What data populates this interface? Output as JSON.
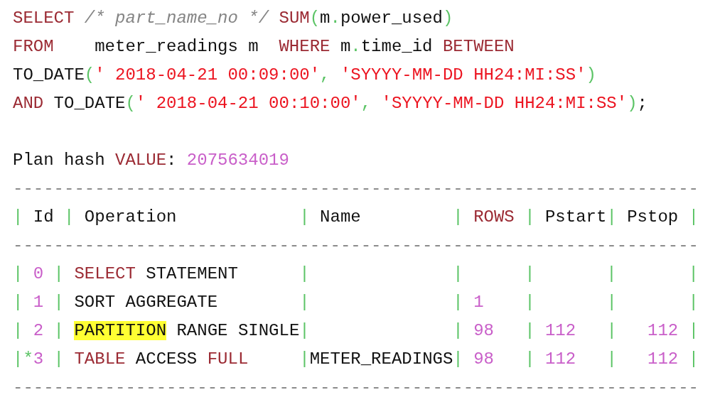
{
  "lines": [
    {
      "kind": "code",
      "tokens": [
        {
          "kind": "kw",
          "text": "SELECT "
        },
        {
          "kind": "cmt",
          "text": "/* part_name_no */ "
        },
        {
          "kind": "kw",
          "text": "SUM"
        },
        {
          "kind": "punct",
          "text": "("
        },
        {
          "kind": "plain",
          "text": "m"
        },
        {
          "kind": "punct",
          "text": "."
        },
        {
          "kind": "plain",
          "text": "power_used"
        },
        {
          "kind": "punct",
          "text": ")"
        }
      ]
    },
    {
      "kind": "code",
      "tokens": [
        {
          "kind": "kw",
          "text": "FROM"
        },
        {
          "kind": "plain",
          "text": "    meter_readings m  "
        },
        {
          "kind": "kw",
          "text": "WHERE"
        },
        {
          "kind": "plain",
          "text": " m"
        },
        {
          "kind": "punct",
          "text": "."
        },
        {
          "kind": "plain",
          "text": "time_id "
        },
        {
          "kind": "kw",
          "text": "BETWEEN"
        }
      ]
    },
    {
      "kind": "code",
      "tokens": [
        {
          "kind": "plain",
          "text": "TO_DATE"
        },
        {
          "kind": "punct",
          "text": "("
        },
        {
          "kind": "str",
          "text": "' 2018-04-21 00:09:00'"
        },
        {
          "kind": "punct",
          "text": ", "
        },
        {
          "kind": "str",
          "text": "'SYYYY-MM-DD HH24:MI:SS'"
        },
        {
          "kind": "punct",
          "text": ")"
        }
      ]
    },
    {
      "kind": "code",
      "tokens": [
        {
          "kind": "kw",
          "text": "AND"
        },
        {
          "kind": "plain",
          "text": " TO_DATE"
        },
        {
          "kind": "punct",
          "text": "("
        },
        {
          "kind": "str",
          "text": "' 2018-04-21 00:10:00'"
        },
        {
          "kind": "punct",
          "text": ", "
        },
        {
          "kind": "str",
          "text": "'SYYYY-MM-DD HH24:MI:SS'"
        },
        {
          "kind": "punct",
          "text": ")"
        },
        {
          "kind": "plain",
          "text": ";"
        }
      ]
    },
    {
      "kind": "blank"
    },
    {
      "kind": "code",
      "tokens": [
        {
          "kind": "plain",
          "text": "Plan hash "
        },
        {
          "kind": "kw",
          "text": "VALUE"
        },
        {
          "kind": "plain",
          "text": ": "
        },
        {
          "kind": "num",
          "text": "2075634019"
        }
      ]
    },
    {
      "kind": "rule",
      "tokens": [
        {
          "kind": "dash",
          "text": "-------------------------------------------------------------------"
        }
      ]
    },
    {
      "kind": "code",
      "tokens": [
        {
          "kind": "punct",
          "text": "|"
        },
        {
          "kind": "plain",
          "text": " Id "
        },
        {
          "kind": "punct",
          "text": "|"
        },
        {
          "kind": "plain",
          "text": " Operation            "
        },
        {
          "kind": "punct",
          "text": "|"
        },
        {
          "kind": "plain",
          "text": " Name         "
        },
        {
          "kind": "punct",
          "text": "| "
        },
        {
          "kind": "kw",
          "text": "ROWS"
        },
        {
          "kind": "punct",
          "text": " |"
        },
        {
          "kind": "plain",
          "text": " Pstart"
        },
        {
          "kind": "punct",
          "text": "|"
        },
        {
          "kind": "plain",
          "text": " Pstop "
        },
        {
          "kind": "punct",
          "text": "|"
        }
      ]
    },
    {
      "kind": "rule",
      "tokens": [
        {
          "kind": "dash",
          "text": "-------------------------------------------------------------------"
        }
      ]
    },
    {
      "kind": "code",
      "tokens": [
        {
          "kind": "punct",
          "text": "| "
        },
        {
          "kind": "num",
          "text": "0"
        },
        {
          "kind": "punct",
          "text": " | "
        },
        {
          "kind": "kw",
          "text": "SELECT"
        },
        {
          "kind": "plain",
          "text": " STATEMENT      "
        },
        {
          "kind": "punct",
          "text": "|              |      |       |       |"
        }
      ]
    },
    {
      "kind": "code",
      "tokens": [
        {
          "kind": "punct",
          "text": "| "
        },
        {
          "kind": "num",
          "text": "1"
        },
        {
          "kind": "punct",
          "text": " |"
        },
        {
          "kind": "plain",
          "text": " SORT AGGREGATE        "
        },
        {
          "kind": "punct",
          "text": "|              | "
        },
        {
          "kind": "num",
          "text": "1"
        },
        {
          "kind": "punct",
          "text": "    |       |       |"
        }
      ]
    },
    {
      "kind": "code",
      "tokens": [
        {
          "kind": "punct",
          "text": "| "
        },
        {
          "kind": "num",
          "text": "2"
        },
        {
          "kind": "punct",
          "text": " | "
        },
        {
          "kind": "mark",
          "text": "PARTITION"
        },
        {
          "kind": "plain",
          "text": " RANGE SINGLE"
        },
        {
          "kind": "punct",
          "text": "|              | "
        },
        {
          "kind": "num",
          "text": "98"
        },
        {
          "kind": "punct",
          "text": "   | "
        },
        {
          "kind": "num",
          "text": "112"
        },
        {
          "kind": "punct",
          "text": "   |   "
        },
        {
          "kind": "num",
          "text": "112"
        },
        {
          "kind": "punct",
          "text": " |"
        }
      ]
    },
    {
      "kind": "code",
      "tokens": [
        {
          "kind": "punct",
          "text": "|*"
        },
        {
          "kind": "num",
          "text": "3"
        },
        {
          "kind": "punct",
          "text": " | "
        },
        {
          "kind": "kw",
          "text": "TABLE"
        },
        {
          "kind": "plain",
          "text": " ACCESS "
        },
        {
          "kind": "kw",
          "text": "FULL     "
        },
        {
          "kind": "punct",
          "text": "|"
        },
        {
          "kind": "plain",
          "text": "METER_READINGS"
        },
        {
          "kind": "punct",
          "text": "| "
        },
        {
          "kind": "num",
          "text": "98"
        },
        {
          "kind": "punct",
          "text": "   | "
        },
        {
          "kind": "num",
          "text": "112"
        },
        {
          "kind": "punct",
          "text": "   |   "
        },
        {
          "kind": "num",
          "text": "112"
        },
        {
          "kind": "punct",
          "text": " |"
        }
      ]
    },
    {
      "kind": "rule",
      "tokens": [
        {
          "kind": "dash",
          "text": "-------------------------------------------------------------------"
        }
      ]
    }
  ]
}
